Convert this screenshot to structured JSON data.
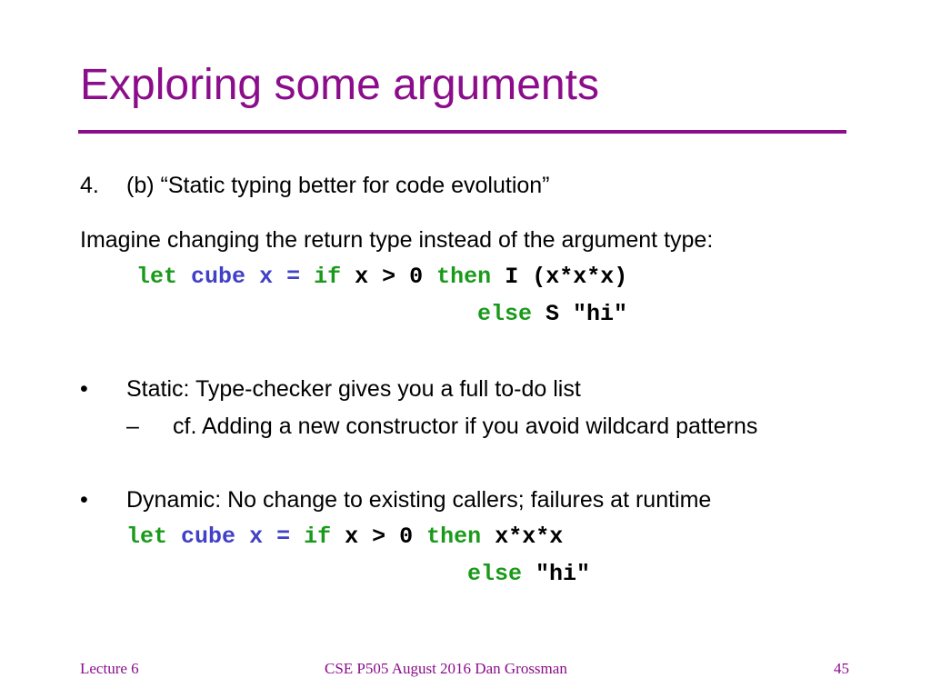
{
  "slide": {
    "title": "Exploring some arguments",
    "accent_color": "#8b0d8b",
    "item_number": "4.",
    "item_text": "(b) “Static typing better for code evolution”",
    "intro": "Imagine changing the return type instead of the argument type:",
    "code1": {
      "line1": [
        {
          "t": "let",
          "c": "kw"
        },
        {
          "t": " ",
          "c": "pl"
        },
        {
          "t": "cube",
          "c": "id"
        },
        {
          "t": " ",
          "c": "pl"
        },
        {
          "t": "x",
          "c": "id"
        },
        {
          "t": " ",
          "c": "pl"
        },
        {
          "t": "=",
          "c": "id"
        },
        {
          "t": " ",
          "c": "pl"
        },
        {
          "t": "if",
          "c": "kw"
        },
        {
          "t": " x > 0 ",
          "c": "pl"
        },
        {
          "t": "then",
          "c": "kw"
        },
        {
          "t": " I (x*x*x)",
          "c": "pl"
        }
      ],
      "line2": [
        {
          "t": "else",
          "c": "kw"
        },
        {
          "t": " S \"hi\"",
          "c": "pl"
        }
      ]
    },
    "bullets": [
      {
        "bullet": "•",
        "text": "Static: Type-checker gives you a full to-do list"
      },
      {
        "bullet": "–",
        "text": "cf. Adding a new constructor if you avoid wildcard patterns"
      },
      {
        "bullet": "•",
        "text": "Dynamic: No change to existing callers; failures at runtime"
      }
    ],
    "code2": {
      "line1": [
        {
          "t": "let",
          "c": "kw"
        },
        {
          "t": " ",
          "c": "pl"
        },
        {
          "t": "cube",
          "c": "id"
        },
        {
          "t": " ",
          "c": "pl"
        },
        {
          "t": "x",
          "c": "id"
        },
        {
          "t": " ",
          "c": "pl"
        },
        {
          "t": "=",
          "c": "id"
        },
        {
          "t": " ",
          "c": "pl"
        },
        {
          "t": "if",
          "c": "kw"
        },
        {
          "t": " x > 0 ",
          "c": "pl"
        },
        {
          "t": "then",
          "c": "kw"
        },
        {
          "t": " x*x*x",
          "c": "pl"
        }
      ],
      "line2": [
        {
          "t": "else",
          "c": "kw"
        },
        {
          "t": " \"hi\"",
          "c": "pl"
        }
      ]
    }
  },
  "footer": {
    "left": "Lecture 6",
    "center": "CSE P505 August 2016  Dan Grossman",
    "page": "45"
  }
}
